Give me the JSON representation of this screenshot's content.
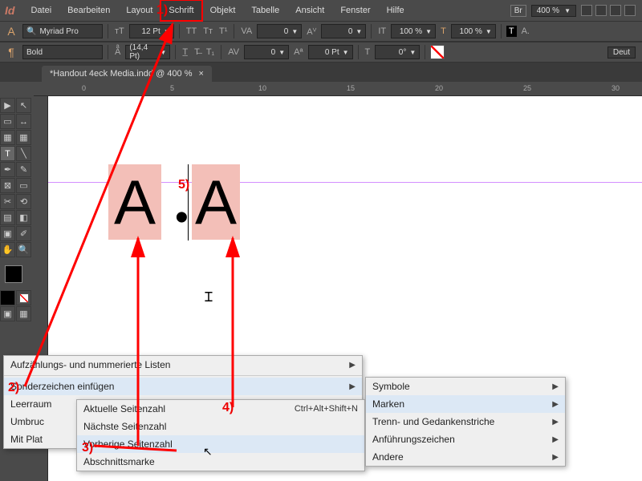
{
  "app": {
    "logo": "Id"
  },
  "menubar": {
    "items": [
      "Datei",
      "Bearbeiten",
      "Layout",
      "Schrift",
      "Objekt",
      "Tabelle",
      "Ansicht",
      "Fenster",
      "Hilfe"
    ],
    "highlight_index": 3,
    "right": {
      "br": "Br",
      "zoom": "400 %"
    }
  },
  "ctrl1": {
    "font": "Myriad Pro",
    "size": "12 Pt",
    "va": "0",
    "aiv": "0",
    "it1": "100 %",
    "it2": "100 %"
  },
  "ctrl2": {
    "weight": "Bold",
    "leading": "(14,4 Pt)",
    "av": "0",
    "t0": "0 Pt",
    "language": "Deut"
  },
  "tab": {
    "title": "*Handout 4eck Media.indd @ 400 %",
    "close": "×"
  },
  "ruler": {
    "ticks": [
      "0",
      "5",
      "10",
      "15",
      "20",
      "25",
      "30"
    ]
  },
  "canvas": {
    "letter1": "A",
    "letter2": "A",
    "bullet": "•"
  },
  "menuA": {
    "items": [
      {
        "label": "Aufzählungs- und nummerierte Listen",
        "arrow": true
      },
      {
        "label": "Sonderzeichen einfügen",
        "arrow": true,
        "hover": true
      },
      {
        "label": "Leerraum",
        "arrow": false
      },
      {
        "label": "Umbruc",
        "arrow": false
      },
      {
        "label": "Mit Plat",
        "arrow": false
      }
    ]
  },
  "menuB": {
    "items": [
      {
        "label": "Aktuelle Seitenzahl",
        "shortcut": "Ctrl+Alt+Shift+N"
      },
      {
        "label": "Nächste Seitenzahl"
      },
      {
        "label": "Vorherige Seitenzahl",
        "hover": true
      },
      {
        "label": "Abschnittsmarke"
      }
    ]
  },
  "menuC": {
    "items": [
      {
        "label": "Symbole",
        "arrow": true
      },
      {
        "label": "Marken",
        "arrow": true,
        "hover": true
      },
      {
        "label": "Trenn- und Gedankenstriche",
        "arrow": true
      },
      {
        "label": "Anführungszeichen",
        "arrow": true
      },
      {
        "label": "Andere",
        "arrow": true
      }
    ]
  },
  "annotations": {
    "a1": "1)",
    "a2": "2)",
    "a3": "3)",
    "a4": "4)",
    "a5": "5)"
  }
}
